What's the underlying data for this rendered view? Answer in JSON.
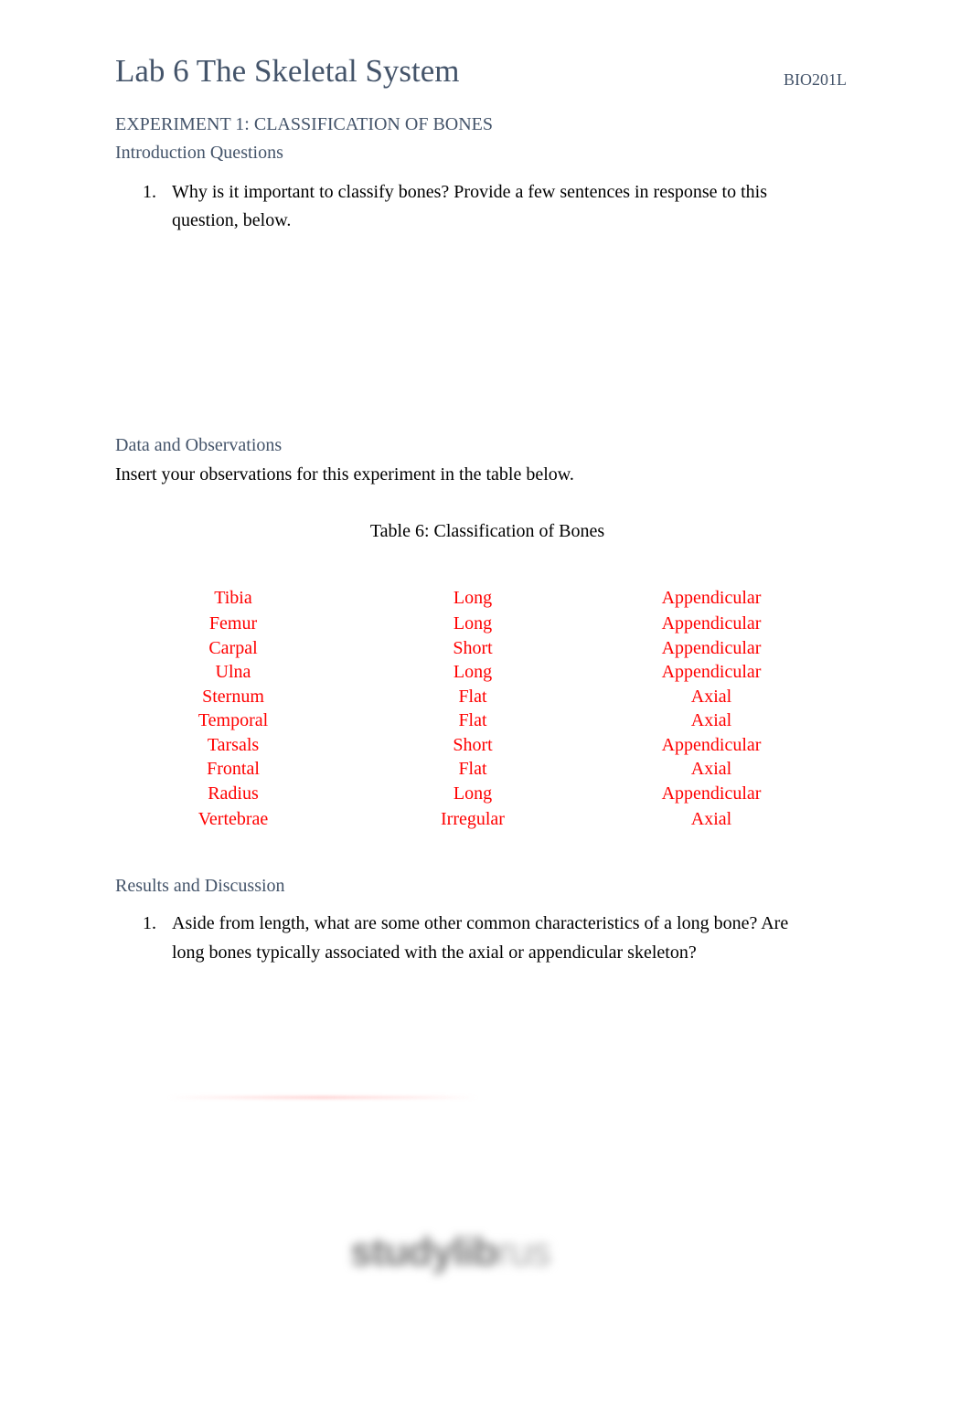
{
  "header": {
    "title": "Lab 6 The Skeletal System",
    "course": "BIO201L"
  },
  "experiment": {
    "heading": "EXPERIMENT 1: CLASSIFICATION OF BONES",
    "intro": {
      "heading": "Introduction Questions",
      "questions": [
        {
          "number": "1.",
          "line1": "Why is it important to classify bones? Provide a few sentences in response to this",
          "line2": "question, below."
        }
      ]
    },
    "data": {
      "heading": "Data and Observations",
      "instruction": "Insert your observations for this experiment in the table below.",
      "table_caption": "Table 6: Classification of Bones",
      "rows": [
        {
          "bone": "Tibia",
          "type": "Long",
          "skeleton": "Appendicular"
        },
        {
          "bone": "Femur",
          "type": "Long",
          "skeleton": "Appendicular"
        },
        {
          "bone": "Carpal",
          "type": "Short",
          "skeleton": "Appendicular"
        },
        {
          "bone": "Ulna",
          "type": "Long",
          "skeleton": "Appendicular"
        },
        {
          "bone": "Sternum",
          "type": "Flat",
          "skeleton": "Axial"
        },
        {
          "bone": "Temporal",
          "type": "Flat",
          "skeleton": "Axial"
        },
        {
          "bone": "Tarsals",
          "type": "Short",
          "skeleton": "Appendicular"
        },
        {
          "bone": "Frontal",
          "type": "Flat",
          "skeleton": "Axial"
        },
        {
          "bone": "Radius",
          "type": "Long",
          "skeleton": "Appendicular"
        },
        {
          "bone": "Vertebrae",
          "type": "Irregular",
          "skeleton": "Axial"
        }
      ]
    },
    "results": {
      "heading": "Results and Discussion",
      "questions": [
        {
          "number": "1.",
          "line1": "Aside from length, what are some other common characteristics of a long bone? Are",
          "line2": "long bones typically associated with the axial or appendicular skeleton?"
        }
      ]
    }
  },
  "watermark": {
    "bold": "studylib",
    "light": "rus"
  },
  "colors": {
    "heading": "#44546a",
    "answer": "#ff0000",
    "body": "#000000"
  }
}
